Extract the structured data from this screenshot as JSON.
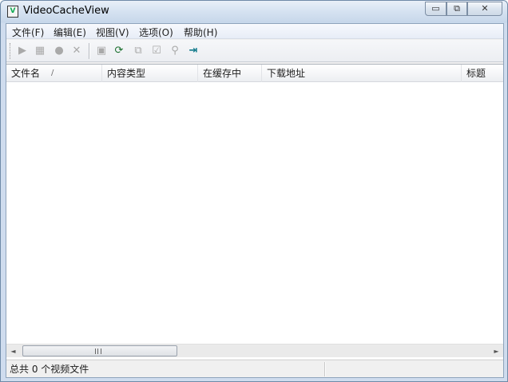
{
  "window": {
    "title": "VideoCacheView",
    "min_glyph": "▭",
    "max_glyph": "⧉",
    "close_glyph": "✕",
    "icon_glyph": "V"
  },
  "menu": {
    "items": [
      {
        "label": "文件(F)"
      },
      {
        "label": "编辑(E)"
      },
      {
        "label": "视图(V)"
      },
      {
        "label": "选项(O)"
      },
      {
        "label": "帮助(H)"
      }
    ]
  },
  "toolbar": {
    "icons": [
      {
        "name": "play-icon",
        "glyph": "▶"
      },
      {
        "name": "copy-files-icon",
        "glyph": "▦"
      },
      {
        "name": "record-icon",
        "glyph": "●"
      },
      {
        "name": "delete-icon",
        "glyph": "✕"
      },
      {
        "name": "save-icon",
        "glyph": "▣"
      },
      {
        "name": "refresh-icon",
        "glyph": "⟳"
      },
      {
        "name": "copy-icon",
        "glyph": "⧉"
      },
      {
        "name": "properties-icon",
        "glyph": "☑"
      },
      {
        "name": "find-icon",
        "glyph": "⚲"
      },
      {
        "name": "exit-icon",
        "glyph": "⇥"
      }
    ]
  },
  "list": {
    "columns": [
      {
        "label": "文件名"
      },
      {
        "label": "内容类型"
      },
      {
        "label": "在缓存中"
      },
      {
        "label": "下载地址"
      },
      {
        "label": "标题"
      }
    ],
    "sort_glyph": "/",
    "rows": []
  },
  "scrollbar": {
    "left_glyph": "◄",
    "right_glyph": "►"
  },
  "status": {
    "text": "总共 0 个视频文件"
  }
}
